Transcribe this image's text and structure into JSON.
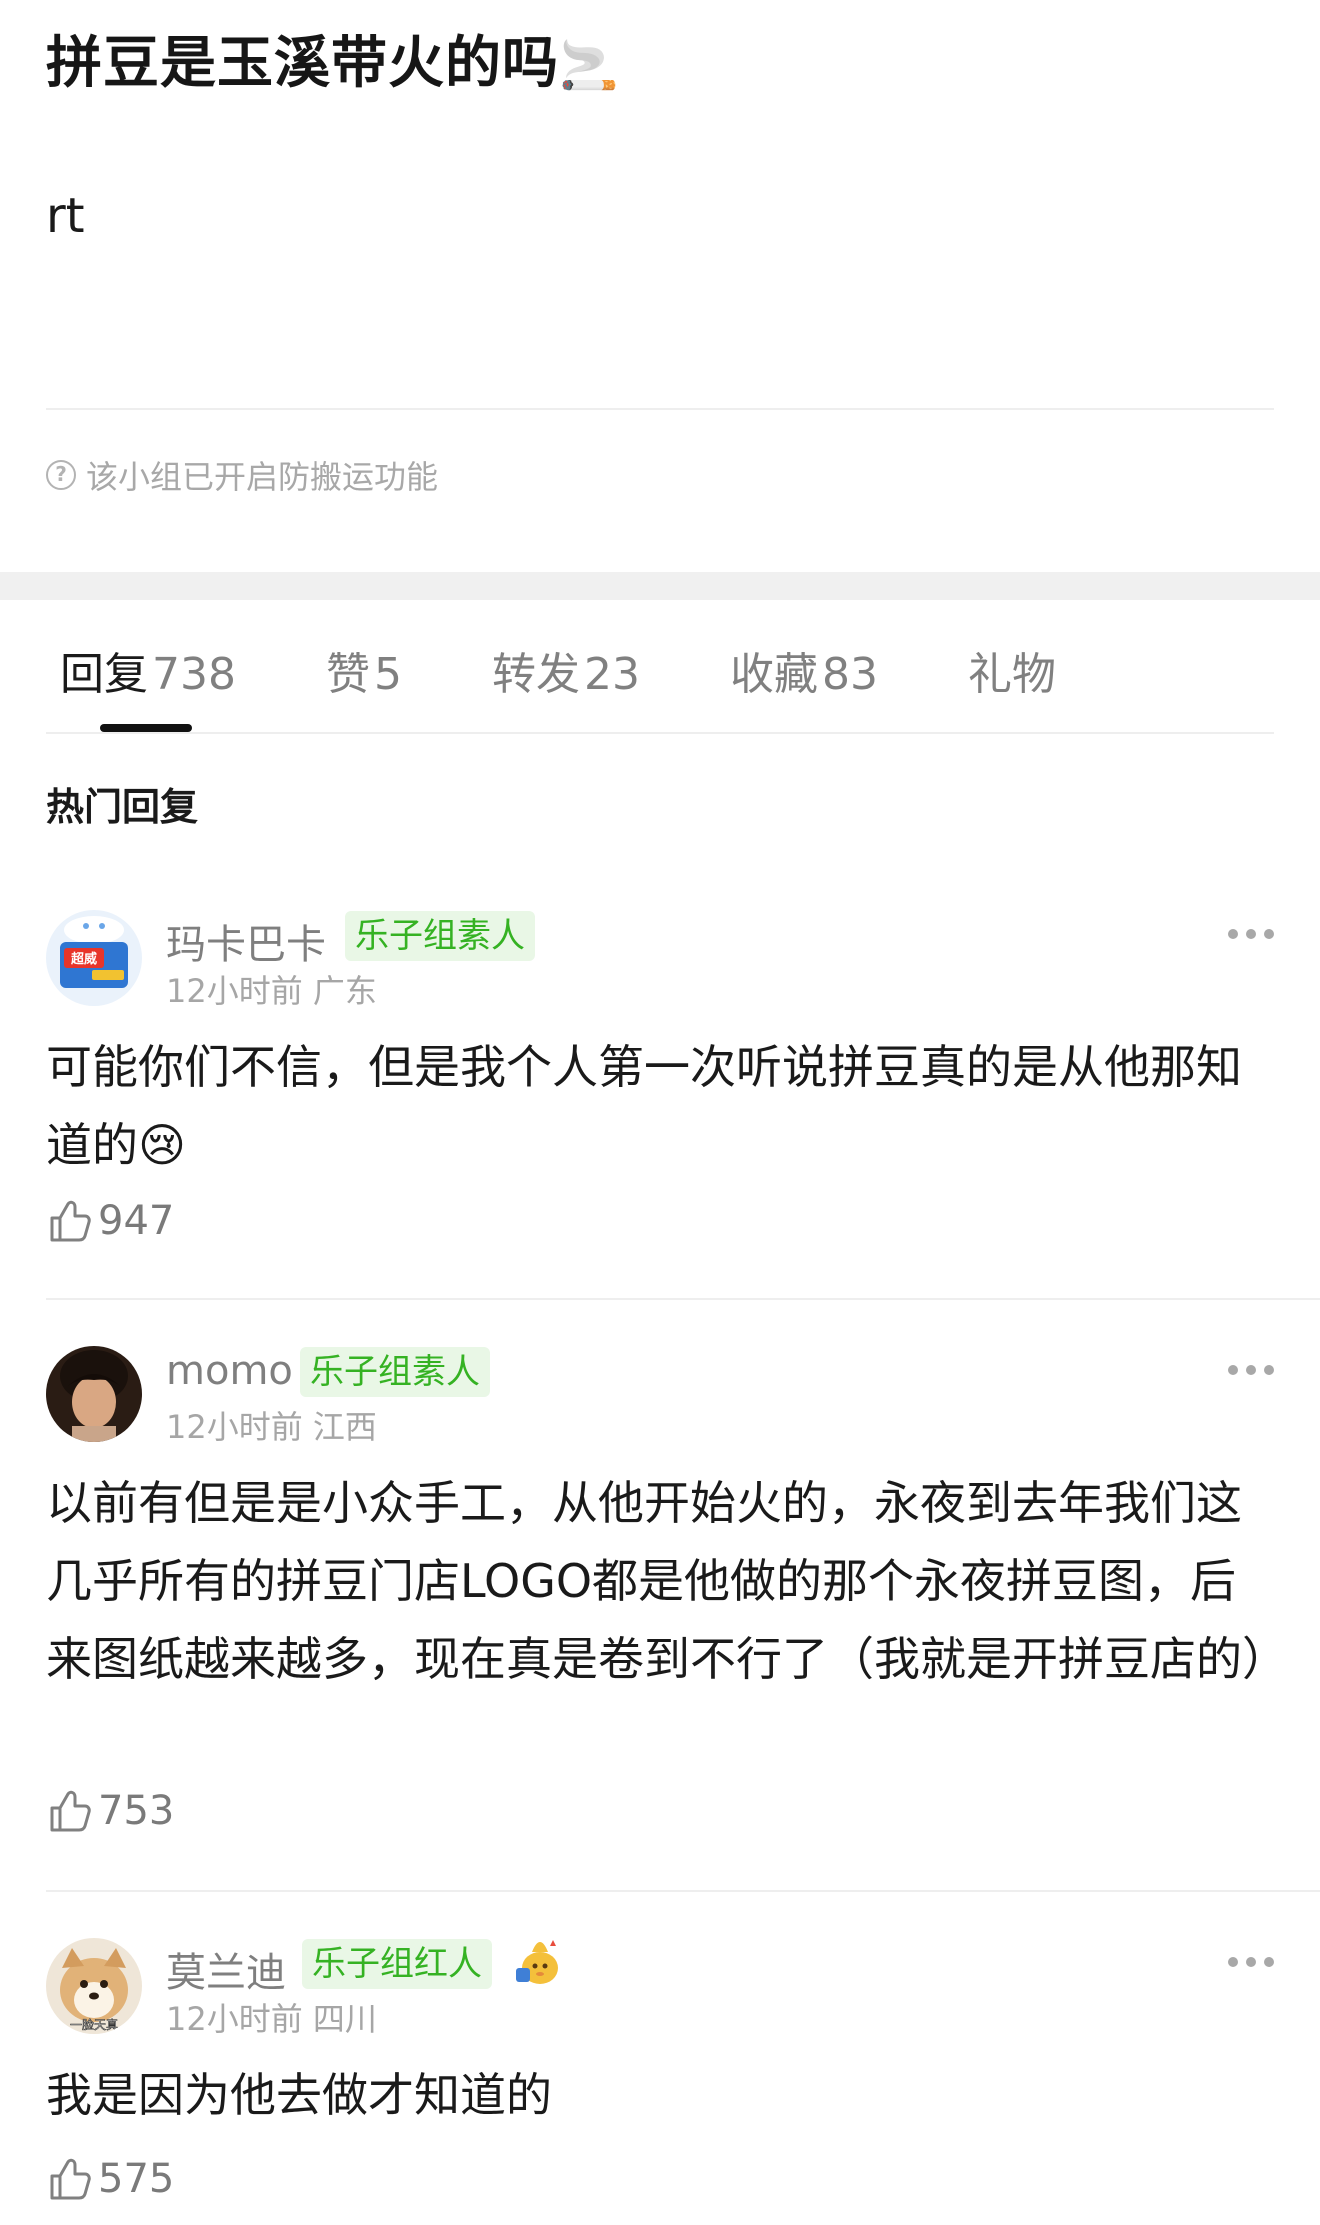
{
  "post": {
    "title": "拼豆是玉溪带火的吗",
    "title_emoji": "🚬",
    "body": "rt",
    "notice": "该小组已开启防搬运功能",
    "notice_icon": "question-circle-icon"
  },
  "tabs": [
    {
      "label": "回复",
      "count": "738",
      "active": true
    },
    {
      "label": "赞",
      "count": "5",
      "active": false
    },
    {
      "label": "转发",
      "count": "23",
      "active": false
    },
    {
      "label": "收藏",
      "count": "83",
      "active": false
    },
    {
      "label": "礼物",
      "count": "",
      "active": false
    }
  ],
  "section_title": "热门回复",
  "comments": [
    {
      "username": "玛卡巴卡",
      "badge": "乐子组素人",
      "time": "12小时前",
      "location": "广东",
      "text": "可能你们不信，但是我个人第一次听说拼豆真的是从他那知道的😢",
      "likes": "947",
      "avatar_text": "超威"
    },
    {
      "username": "momo",
      "badge": "乐子组素人",
      "time": "12小时前",
      "location": "江西",
      "text": "以前有但是是小众手工，从他开始火的，永夜到去年我们这几乎所有的拼豆门店LOGO都是他做的那个永夜拼豆图，后来图纸越来越多，现在真是卷到不行了（我就是开拼豆店的）",
      "likes": "753"
    },
    {
      "username": "莫兰迪",
      "badge": "乐子组红人",
      "time": "12小时前",
      "location": "四川",
      "text": "我是因为他去做才知道的",
      "likes": "575",
      "avatar_text": "一脸天真",
      "badge_extra_icon": "gift-mascot-icon"
    }
  ],
  "colors": {
    "badge_bg": "#e9f7e6",
    "badge_text": "#35b223",
    "muted": "#a6a6a6",
    "divider": "#eeeeee"
  }
}
